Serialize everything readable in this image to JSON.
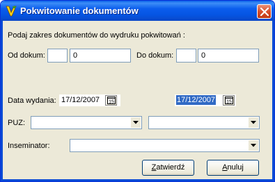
{
  "window": {
    "title": "Pokwitowanie dokumentów",
    "app_icon": "app-logo-icon",
    "close_icon": "close-icon"
  },
  "prompt": "Podaj zakres dokumentów do wydruku pokwitowań :",
  "range": {
    "from_label": "Od dokum:",
    "from_prefix": "",
    "from_value": "0",
    "to_label": "Do dokum:",
    "to_prefix": "",
    "to_value": "0"
  },
  "date": {
    "label": "Data wydania:",
    "value1": "17/12/2007",
    "value2": "17/12/2007",
    "calendar_icon": "calendar-icon",
    "calendar_glyph": "15"
  },
  "puz": {
    "label": "PUZ:",
    "value1": "",
    "value2": ""
  },
  "inseminator": {
    "label": "Inseminator:",
    "value": ""
  },
  "buttons": {
    "ok_mnemonic": "Z",
    "ok_rest": "atwierdź",
    "cancel_mnemonic": "A",
    "cancel_rest": "nuluj"
  },
  "colors": {
    "titlebar": "#0a5fe8",
    "dialog_bg": "#ece9d8",
    "selection": "#316ac5",
    "close_red": "#d9502c"
  }
}
